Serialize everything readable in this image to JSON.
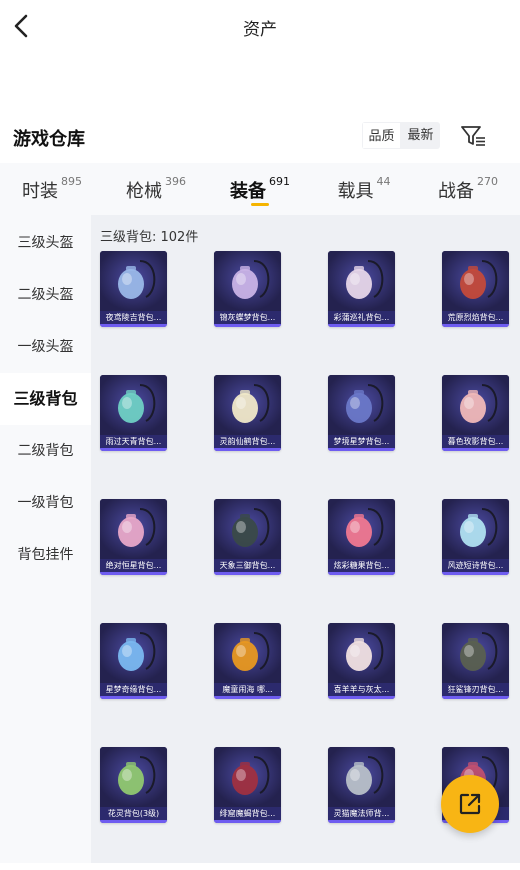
{
  "header": {
    "title": "资产"
  },
  "warehouse": {
    "title": "游戏仓库",
    "sort_options": [
      "品质",
      "最新"
    ],
    "sort_active": "品质"
  },
  "tabs": [
    {
      "label": "时装",
      "count": "895",
      "active": false
    },
    {
      "label": "枪械",
      "count": "396",
      "active": false
    },
    {
      "label": "装备",
      "count": "691",
      "active": true
    },
    {
      "label": "载具",
      "count": "44",
      "active": false
    },
    {
      "label": "战备",
      "count": "270",
      "active": false
    }
  ],
  "sidebar": {
    "items": [
      "三级头盔",
      "二级头盔",
      "一级头盔",
      "三级背包",
      "二级背包",
      "一级背包",
      "背包挂件"
    ],
    "active": "三级背包"
  },
  "content": {
    "count_text": "三级背包: 102件",
    "items": [
      {
        "name": "夜鸢陵吉背包...",
        "accent": "#9ab8e8"
      },
      {
        "name": "锦灰蝶梦背包...",
        "accent": "#c9b3e6"
      },
      {
        "name": "彩蒲巡礼背包...",
        "accent": "#e6d6e8"
      },
      {
        "name": "荒原烈焰背包...",
        "accent": "#c44a3a"
      },
      {
        "name": "雨过天青背包...",
        "accent": "#6fd0c4"
      },
      {
        "name": "灵韵仙鹤背包...",
        "accent": "#f0e8c8"
      },
      {
        "name": "梦境星梦背包...",
        "accent": "#6a78c8"
      },
      {
        "name": "暮色玫影背包...",
        "accent": "#f0b8b8"
      },
      {
        "name": "绝对恒星背包...",
        "accent": "#e8a8c8"
      },
      {
        "name": "天象三御背包...",
        "accent": "#3a4a48"
      },
      {
        "name": "炫彩糖果背包...",
        "accent": "#f07890"
      },
      {
        "name": "风迹短诗背包...",
        "accent": "#b0e0f0"
      },
      {
        "name": "星梦奇缘背包...",
        "accent": "#7ab8f0"
      },
      {
        "name": "魔童闹海 哪...",
        "accent": "#e89820"
      },
      {
        "name": "喜羊羊与灰太...",
        "accent": "#f0e0e0"
      },
      {
        "name": "狂鲨锋刃背包...",
        "accent": "#5a6050"
      },
      {
        "name": "花灵背包(3级)",
        "accent": "#90c870"
      },
      {
        "name": "绯窟魔蝎背包...",
        "accent": "#a03040"
      },
      {
        "name": "灵猫魔法师背...",
        "accent": "#b8c0c8"
      },
      {
        "name": "",
        "accent": "#c05070"
      }
    ]
  },
  "colors": {
    "accent_yellow": "#f8b514",
    "card_bg": "#2a275f",
    "card_bar": "#6e5cf0"
  },
  "icons": {
    "back": "chevron-left-icon",
    "filter": "filter-icon",
    "fab": "share-icon"
  }
}
